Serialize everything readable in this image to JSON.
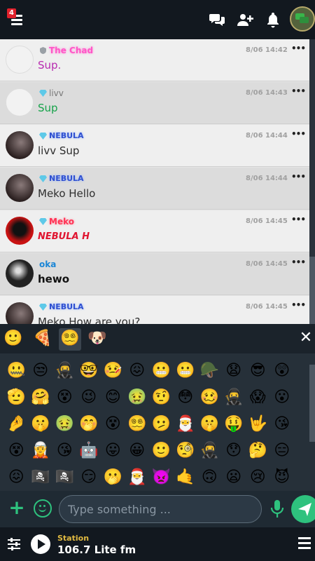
{
  "topbar": {
    "notification_count": "4",
    "icons": [
      "menu-icon",
      "chat-bubbles-icon",
      "add-user-icon",
      "bell-icon",
      "chat-room-icon"
    ]
  },
  "messages": [
    {
      "username": "The Chad",
      "username_color": "#ff57c7",
      "text": "Sup.",
      "text_color": "#b82bb0",
      "time": "8/06 14:42",
      "avatar_color": "#f2f2f2"
    },
    {
      "username": "livv",
      "username_color": "#777777",
      "text": "Sup",
      "text_color": "#16a34a",
      "time": "8/06 14:43",
      "avatar_color": "#f2f2f2"
    },
    {
      "username": "NEBULA",
      "username_color": "#3050d0",
      "text": "livv Sup",
      "text_color": "#2e2e2e",
      "time": "8/06 14:44",
      "avatar_color": "#3a2a2a"
    },
    {
      "username": "NEBULA",
      "username_color": "#3050d0",
      "text": "Meko Hello",
      "text_color": "#2e2e2e",
      "time": "8/06 14:44",
      "avatar_color": "#3a2a2a"
    },
    {
      "username": "Meko",
      "username_color": "#ff3355",
      "text": "NEBULA H",
      "text_color": "#e01530",
      "time": "8/06 14:45",
      "avatar_color": "#b01010"
    },
    {
      "username": "oka",
      "username_color": "#1b86d6",
      "text": "hewo",
      "text_color": "#111111",
      "time": "8/06 14:45",
      "avatar_color": "#2b2b2b"
    },
    {
      "username": "NEBULA",
      "username_color": "#3050d0",
      "text": "Meko How are you?",
      "text_color": "#2e2e2e",
      "time": "8/06 14:45",
      "avatar_color": "#3a2a2a"
    }
  ],
  "emoji_tabs": [
    "🙂",
    "🍕",
    "😵‍💫",
    "🐶"
  ],
  "emoji_grid": [
    "🤐",
    "😒",
    "🥷",
    "🤓",
    "🤒",
    "😖",
    "😬",
    "😬",
    "🪖",
    "😧",
    "😎",
    "😲",
    "🫡",
    "🤗",
    "😵",
    "😉",
    "😊",
    "🤢",
    "🤨",
    "😳",
    "🥴",
    "🥷",
    "😱",
    "😮",
    "🤌",
    "🤫",
    "🤢",
    "🤭",
    "😵",
    "😵‍💫",
    "🫤",
    "🎅",
    "🤫",
    "🤑",
    "🤟",
    "😘",
    "😵",
    "🧝",
    "😘",
    "🤖",
    "😛",
    "😀",
    "🙂",
    "🧐",
    "🥷",
    "😯",
    "🤔",
    "😑",
    "😖",
    "🏴‍☠️",
    "🏴‍☠️",
    "😏",
    "🫢",
    "🎅",
    "👿",
    "🤙",
    "🙃",
    "😦",
    "😢",
    "😈"
  ],
  "input": {
    "placeholder": "Type something ..."
  },
  "player": {
    "station_label": "Station",
    "station_name": "106.7 Lite fm"
  },
  "colors": {
    "accent": "#2ec27e",
    "station_label": "#e0b941"
  }
}
